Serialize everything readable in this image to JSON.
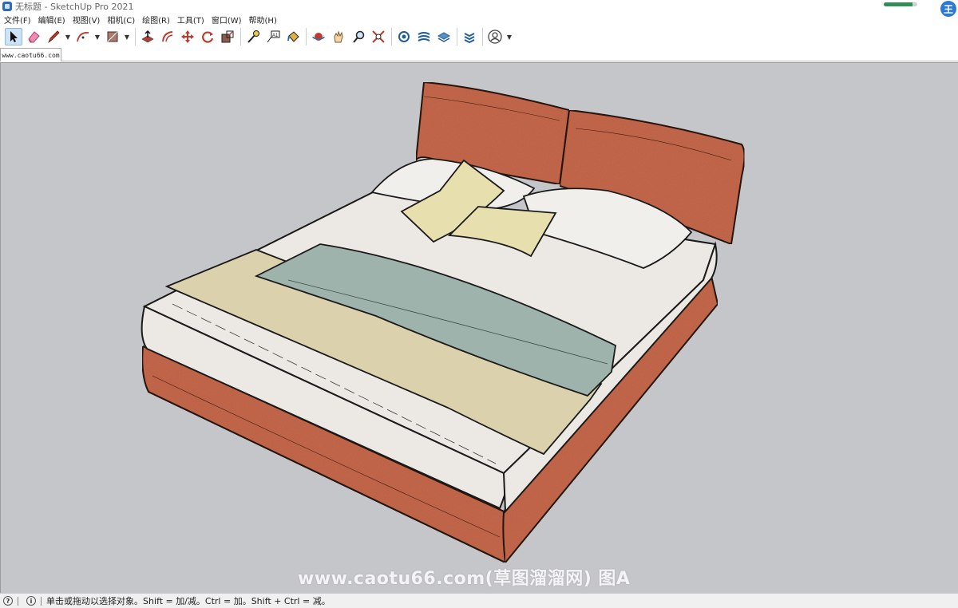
{
  "window": {
    "title": "无标题 - SketchUp Pro 2021",
    "user_badge": "王",
    "progress": 0.85
  },
  "menu": {
    "items": [
      {
        "label": "文件(F)"
      },
      {
        "label": "编辑(E)"
      },
      {
        "label": "视图(V)"
      },
      {
        "label": "相机(C)"
      },
      {
        "label": "绘图(R)"
      },
      {
        "label": "工具(T)"
      },
      {
        "label": "窗口(W)"
      },
      {
        "label": "帮助(H)"
      }
    ]
  },
  "toolbar": {
    "tools": [
      {
        "icon": "select-arrow-icon",
        "active": true
      },
      {
        "icon": "eraser-icon"
      },
      {
        "icon": "pencil-line-icon"
      },
      {
        "icon": "arc-icon"
      },
      {
        "icon": "rectangle-shape-icon"
      },
      {
        "icon": "push-pull-icon"
      },
      {
        "icon": "offset-icon"
      },
      {
        "icon": "move-icon"
      },
      {
        "icon": "rotate-icon"
      },
      {
        "icon": "scale-icon"
      },
      {
        "icon": "tape-measure-icon"
      },
      {
        "icon": "text-label-icon"
      },
      {
        "icon": "paint-bucket-icon"
      },
      {
        "icon": "orbit-icon"
      },
      {
        "icon": "pan-hand-icon"
      },
      {
        "icon": "zoom-icon"
      },
      {
        "icon": "zoom-extents-icon"
      },
      {
        "icon": "warehouse-icon"
      },
      {
        "icon": "extension-warehouse-icon"
      },
      {
        "icon": "layout-icon"
      },
      {
        "icon": "extension-manager-icon"
      },
      {
        "icon": "account-icon"
      }
    ]
  },
  "scene_tab": {
    "label": "www.caotu66.com"
  },
  "viewport": {
    "background": "#c5c6ca",
    "watermark": "www.caotu66.com(草图溜溜网) 图A",
    "colors": {
      "frame": "#c96a4e",
      "mattress": "#ece8e4",
      "throw_beige": "#dbd1ad",
      "blanket_teal": "#9fb3ad",
      "pillow_white": "#f1efec",
      "pillow_yellow": "#e8dfae"
    }
  },
  "status": {
    "text": "单击或拖动以选择对象。Shift = 加/减。Ctrl = 加。Shift + Ctrl = 减。"
  }
}
